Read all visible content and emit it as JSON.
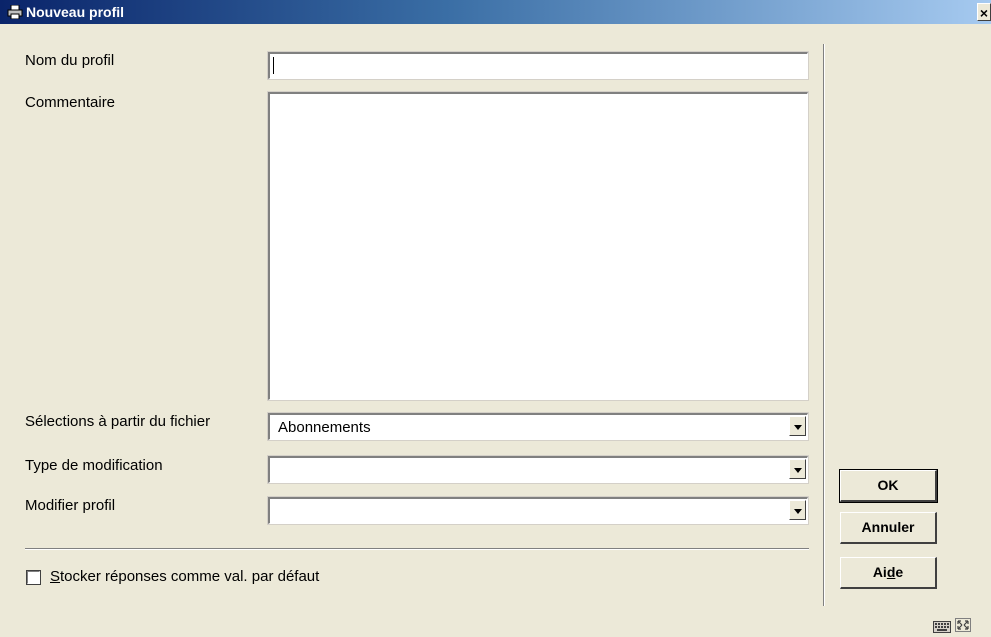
{
  "window": {
    "title": "Nouveau profil",
    "close_glyph": "×",
    "icon": "printer-icon"
  },
  "form": {
    "profile_name": {
      "label": "Nom du profil",
      "value": ""
    },
    "comment": {
      "label": "Commentaire",
      "value": ""
    },
    "selection_file": {
      "label": "Sélections à partir du fichier",
      "value": "Abonnements"
    },
    "modification_type": {
      "label": "Type de modification",
      "value": ""
    },
    "modify_profile": {
      "label": "Modifier profil",
      "value": ""
    }
  },
  "options": {
    "store_defaults": {
      "access_key": "S",
      "label_rest": "tocker réponses comme val. par défaut",
      "checked": false
    }
  },
  "buttons": {
    "ok": {
      "label": "OK"
    },
    "cancel": {
      "label": "Annuler"
    },
    "help": {
      "before": "Ai",
      "key": "d",
      "after": "e"
    }
  },
  "statusbar": {
    "icons": [
      "keyboard-icon",
      "resize-icon"
    ]
  }
}
